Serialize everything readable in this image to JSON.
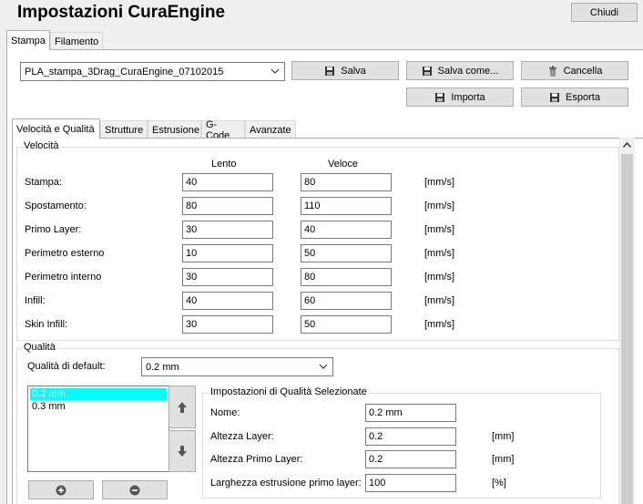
{
  "window": {
    "title": "Impostazioni CuraEngine",
    "close_label": "Chiudi"
  },
  "main_tabs": [
    {
      "label": "Stampa",
      "active": true
    },
    {
      "label": "Filamento",
      "active": false
    }
  ],
  "profile": {
    "selected": "PLA_stampa_3Drag_CuraEngine_07102015",
    "save_label": "Salva",
    "save_as_label": "Salva come...",
    "delete_label": "Cancella",
    "import_label": "Importa",
    "export_label": "Esporta"
  },
  "sub_tabs": [
    {
      "label": "Velocità e Qualità",
      "active": true
    },
    {
      "label": "Strutture",
      "active": false
    },
    {
      "label": "Estrusione",
      "active": false
    },
    {
      "label": "G-Code",
      "active": false
    },
    {
      "label": "Avanzate",
      "active": false
    }
  ],
  "speed": {
    "title": "Velocità",
    "col_slow": "Lento",
    "col_fast": "Veloce",
    "unit": "[mm/s]",
    "rows": [
      {
        "label": "Stampa:",
        "slow": "40",
        "fast": "80"
      },
      {
        "label": "Spostamento:",
        "slow": "80",
        "fast": "110"
      },
      {
        "label": "Primo Layer:",
        "slow": "30",
        "fast": "40"
      },
      {
        "label": "Perimetro esterno",
        "slow": "10",
        "fast": "50"
      },
      {
        "label": "Perimetro interno",
        "slow": "30",
        "fast": "80"
      },
      {
        "label": "Infill:",
        "slow": "40",
        "fast": "60"
      },
      {
        "label": "Skin Infill:",
        "slow": "30",
        "fast": "50"
      }
    ]
  },
  "quality": {
    "title": "Qualità",
    "default_label": "Qualità di default:",
    "default_value": "0.2 mm",
    "list": [
      {
        "label": "0.2 mm",
        "selected": true
      },
      {
        "label": "0.3 mm",
        "selected": false
      }
    ],
    "selected_group_title": "Impostazioni di Qualità Selezionate",
    "name_label": "Nome:",
    "name_value": "0.2 mm",
    "layer_height_label": "Altezza Layer:",
    "layer_height_value": "0.2",
    "layer_height_unit": "[mm]",
    "first_layer_label": "Altezza Primo Layer:",
    "first_layer_value": "0.2",
    "first_layer_unit": "[mm]",
    "extrusion_width_label": "Larghezza estrusione primo layer:",
    "extrusion_width_value": "100",
    "extrusion_width_unit": "[%]"
  },
  "colors": {
    "accent_selection": "#00ffff",
    "window_bg": "#f0f0f0",
    "panel_bg": "#ffffff"
  }
}
